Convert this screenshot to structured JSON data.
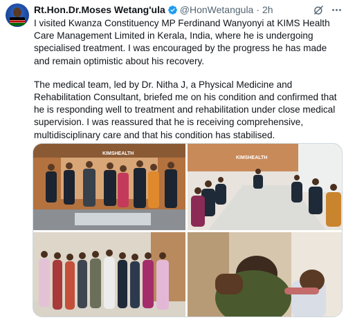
{
  "tweet": {
    "display_name": "Rt.Hon.Dr.Moses Wetang'ula",
    "handle": "@HonWetangula",
    "separator": "·",
    "time": "2h",
    "paragraphs": [
      "I visited Kwanza Constituency MP Ferdinand Wanyonyi at KIMS Health Care Management Limited in Kerala, India, where he is undergoing specialised treatment. I was encouraged by the progress he has made and remain optimistic about his recovery.",
      "The medical team, led by Dr. Nitha J, a Physical Medicine and Rehabilitation Consultant, briefed me on his condition and confirmed that he is responding well to treatment and rehabilitation under close medical supervision. I was reassured that he is receiving comprehensive, multidisciplinary care and that his condition has stabilised."
    ],
    "media": {
      "photo1_sign": "KIMSHEALTH",
      "photo2_sign": "KIMSHEALTH"
    }
  },
  "icons": {
    "verified": "verified-badge-icon",
    "grok": "grok-icon",
    "more": "more-icon"
  },
  "colors": {
    "text": "#0f1419",
    "secondary": "#536471",
    "verified": "#1d9bf0"
  }
}
